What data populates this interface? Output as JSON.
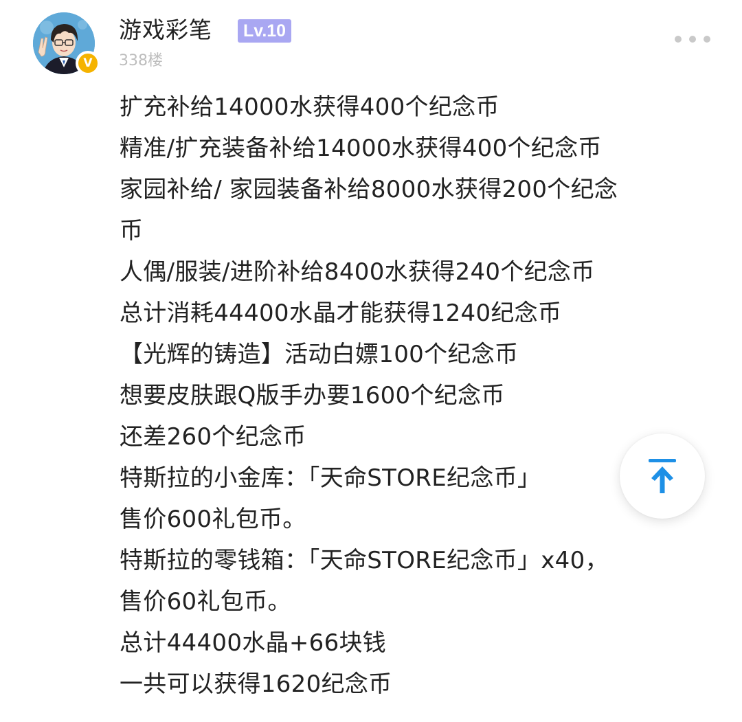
{
  "post": {
    "author": {
      "name": "游戏彩笔",
      "level": "Lv.10",
      "verified_mark": "V"
    },
    "floor": "338楼",
    "lines": [
      "扩充补给14000水获得400个纪念币",
      "精准/扩充装备补给14000水获得400个纪念币",
      "家园补给/ 家园装备补给8000水获得200个纪念",
      "币",
      "人偶/服装/进阶补给8400水获得240个纪念币",
      "总计消耗44400水晶才能获得1240纪念币",
      "【光辉的铸造】活动白嫖100个纪念币",
      "想要皮肤跟Q版手办要1600个纪念币",
      "还差260个纪念币",
      "特斯拉的小金库：「天命STORE纪念币」",
      "售价600礼包币。",
      "特斯拉的零钱箱：「天命STORE纪念币」x40，",
      "售价60礼包币。",
      "总计44400水晶+66块钱",
      "一共可以获得1620纪念币"
    ]
  },
  "icons": {
    "more": "more-dots-icon",
    "back_to_top": "arrow-up-to-top-icon",
    "verified": "verified-v-icon"
  },
  "colors": {
    "level_badge": "#a9a7f2",
    "verified_badge": "#f5b300",
    "back_top_arrow": "#1e90e6",
    "meta_text": "#bdbdbd"
  }
}
